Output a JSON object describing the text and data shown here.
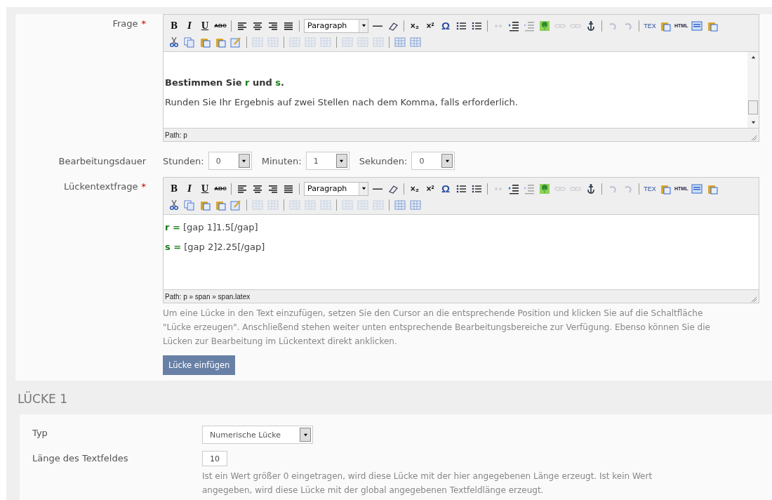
{
  "question_form": {
    "question": {
      "label": "Frage",
      "required_mark": "*",
      "editor": {
        "toolbar_rows": [
          [
            {
              "kind": "bold",
              "label": "B",
              "disabled": false
            },
            {
              "kind": "italic",
              "label": "I",
              "disabled": false
            },
            {
              "kind": "underline",
              "label": "U",
              "disabled": false
            },
            {
              "kind": "strike",
              "label": "ABC",
              "disabled": false
            },
            {
              "kind": "sep"
            },
            {
              "kind": "align-left",
              "disabled": false
            },
            {
              "kind": "align-center",
              "disabled": false
            },
            {
              "kind": "align-right",
              "disabled": false
            },
            {
              "kind": "align-justify",
              "disabled": false
            },
            {
              "kind": "sep"
            },
            {
              "kind": "select",
              "label": "Paragraph",
              "disabled": false
            },
            {
              "kind": "rule",
              "disabled": false
            },
            {
              "kind": "eraser",
              "disabled": false
            },
            {
              "kind": "sep"
            },
            {
              "kind": "sub",
              "label": "×₂",
              "disabled": false
            },
            {
              "kind": "sup",
              "label": "×²",
              "disabled": false
            },
            {
              "kind": "omega",
              "label": "Ω",
              "disabled": false
            },
            {
              "kind": "bullets",
              "disabled": false
            },
            {
              "kind": "numbers",
              "disabled": false
            },
            {
              "kind": "sep"
            },
            {
              "kind": "quote",
              "disabled": true
            },
            {
              "kind": "indent",
              "disabled": false
            },
            {
              "kind": "outdent",
              "disabled": true
            },
            {
              "kind": "image",
              "disabled": false
            },
            {
              "kind": "link",
              "disabled": true
            },
            {
              "kind": "unlink",
              "disabled": true
            },
            {
              "kind": "anchor",
              "disabled": false
            },
            {
              "kind": "sep"
            },
            {
              "kind": "undo",
              "disabled": true
            },
            {
              "kind": "redo",
              "disabled": true
            },
            {
              "kind": "sep"
            },
            {
              "kind": "tex",
              "label": "TEX",
              "disabled": false
            },
            {
              "kind": "clipboard",
              "disabled": false
            },
            {
              "kind": "html",
              "label": "HTML",
              "disabled": false
            },
            {
              "kind": "panel",
              "disabled": false
            },
            {
              "kind": "clipboard",
              "disabled": false
            }
          ],
          [
            {
              "kind": "cut",
              "disabled": false
            },
            {
              "kind": "copy",
              "disabled": false
            },
            {
              "kind": "clipboard",
              "disabled": false
            },
            {
              "kind": "clipboard",
              "disabled": false
            },
            {
              "kind": "edit",
              "disabled": false
            },
            {
              "kind": "sep"
            },
            {
              "kind": "table",
              "disabled": true
            },
            {
              "kind": "table",
              "disabled": true
            },
            {
              "kind": "sep"
            },
            {
              "kind": "table",
              "disabled": true
            },
            {
              "kind": "table",
              "disabled": true
            },
            {
              "kind": "table",
              "disabled": true
            },
            {
              "kind": "sep"
            },
            {
              "kind": "table",
              "disabled": true
            },
            {
              "kind": "table",
              "disabled": true
            },
            {
              "kind": "table",
              "disabled": true
            },
            {
              "kind": "sep"
            },
            {
              "kind": "table",
              "disabled": false
            },
            {
              "kind": "table",
              "disabled": false
            }
          ]
        ],
        "scrollbar": true,
        "paragraphs": [
          [
            {
              "text": "Bestimmen Sie ",
              "kind": "bold"
            },
            {
              "text": "r",
              "kind": "variable"
            },
            {
              "text": " und ",
              "kind": "bold"
            },
            {
              "text": "s",
              "kind": "variable"
            },
            {
              "text": ".",
              "kind": "bold"
            }
          ],
          [
            {
              "text": "Runden Sie Ihr Ergebnis auf zwei Stellen nach dem Komma, falls erforderlich.",
              "kind": "plain"
            }
          ]
        ],
        "path": "Path: p"
      }
    },
    "duration": {
      "label": "Bearbeitungsdauer",
      "fields": [
        {
          "label": "Stunden:",
          "value": "0"
        },
        {
          "label": "Minuten:",
          "value": "1"
        },
        {
          "label": "Sekunden:",
          "value": "0"
        }
      ]
    },
    "cloze": {
      "label": "Lückentextfrage",
      "required_mark": "*",
      "editor": {
        "toolbar_rows": [
          [
            {
              "kind": "bold",
              "label": "B",
              "disabled": false
            },
            {
              "kind": "italic",
              "label": "I",
              "disabled": false
            },
            {
              "kind": "underline",
              "label": "U",
              "disabled": false
            },
            {
              "kind": "strike",
              "label": "ABC",
              "disabled": false
            },
            {
              "kind": "sep"
            },
            {
              "kind": "align-left",
              "disabled": false
            },
            {
              "kind": "align-center",
              "disabled": false
            },
            {
              "kind": "align-right",
              "disabled": false
            },
            {
              "kind": "align-justify",
              "disabled": false
            },
            {
              "kind": "sep"
            },
            {
              "kind": "select",
              "label": "Paragraph",
              "disabled": false
            },
            {
              "kind": "rule",
              "disabled": false
            },
            {
              "kind": "eraser",
              "disabled": false
            },
            {
              "kind": "sep"
            },
            {
              "kind": "sub",
              "label": "×₂",
              "disabled": false
            },
            {
              "kind": "sup",
              "label": "×²",
              "disabled": false
            },
            {
              "kind": "omega",
              "label": "Ω",
              "disabled": false
            },
            {
              "kind": "bullets",
              "disabled": false
            },
            {
              "kind": "numbers",
              "disabled": false
            },
            {
              "kind": "sep"
            },
            {
              "kind": "quote",
              "disabled": true
            },
            {
              "kind": "indent",
              "disabled": false
            },
            {
              "kind": "outdent",
              "disabled": true
            },
            {
              "kind": "image",
              "disabled": false
            },
            {
              "kind": "link",
              "disabled": true
            },
            {
              "kind": "unlink",
              "disabled": true
            },
            {
              "kind": "anchor",
              "disabled": false
            },
            {
              "kind": "sep"
            },
            {
              "kind": "undo",
              "disabled": true
            },
            {
              "kind": "redo",
              "disabled": true
            },
            {
              "kind": "sep"
            },
            {
              "kind": "tex",
              "label": "TEX",
              "disabled": false
            },
            {
              "kind": "clipboard",
              "disabled": false
            },
            {
              "kind": "html",
              "label": "HTML",
              "disabled": false
            },
            {
              "kind": "panel",
              "disabled": false
            },
            {
              "kind": "clipboard",
              "disabled": false
            }
          ],
          [
            {
              "kind": "cut",
              "disabled": false
            },
            {
              "kind": "copy",
              "disabled": false
            },
            {
              "kind": "clipboard",
              "disabled": false
            },
            {
              "kind": "clipboard",
              "disabled": false
            },
            {
              "kind": "edit",
              "disabled": false
            },
            {
              "kind": "sep"
            },
            {
              "kind": "table",
              "disabled": true
            },
            {
              "kind": "table",
              "disabled": true
            },
            {
              "kind": "sep"
            },
            {
              "kind": "table",
              "disabled": true
            },
            {
              "kind": "table",
              "disabled": true
            },
            {
              "kind": "table",
              "disabled": true
            },
            {
              "kind": "sep"
            },
            {
              "kind": "table",
              "disabled": true
            },
            {
              "kind": "table",
              "disabled": true
            },
            {
              "kind": "table",
              "disabled": true
            },
            {
              "kind": "sep"
            },
            {
              "kind": "table",
              "disabled": false
            },
            {
              "kind": "table",
              "disabled": false
            }
          ]
        ],
        "scrollbar": false,
        "paragraphs": [
          [
            {
              "text": "r =",
              "kind": "variable"
            },
            {
              "text": " [gap 1]1.5[/gap]",
              "kind": "plain"
            }
          ],
          [
            {
              "text": "s =",
              "kind": "variable"
            },
            {
              "text": " [gap 2]2.25[/gap]",
              "kind": "plain"
            }
          ]
        ],
        "path": "Path: p » span » span.latex"
      },
      "help": "Um eine Lücke in den Text einzufügen, setzen Sie den Cursor an die entsprechende Position und klicken Sie auf die Schaltfläche \"Lücke erzeugen\". Anschließend stehen weiter unten entsprechende Bearbeitungsbereiche zur Verfügung. Ebenso können Sie die Lücken zur Bearbeitung im Lückentext direkt anklicken.",
      "button": "Lücke einfügen"
    }
  },
  "gap_section": {
    "heading": "LÜCKE 1",
    "type": {
      "label": "Typ",
      "value": "Numerische Lücke"
    },
    "length": {
      "label": "Länge des Textfeldes",
      "value": "10",
      "help": "Ist ein Wert größer 0 eingetragen, wird diese Lücke mit der hier angegebenen Länge erzeugt. Ist kein Wert angegeben, wird diese Lücke mit der global angegebenen Textfeldlänge erzeugt."
    }
  }
}
